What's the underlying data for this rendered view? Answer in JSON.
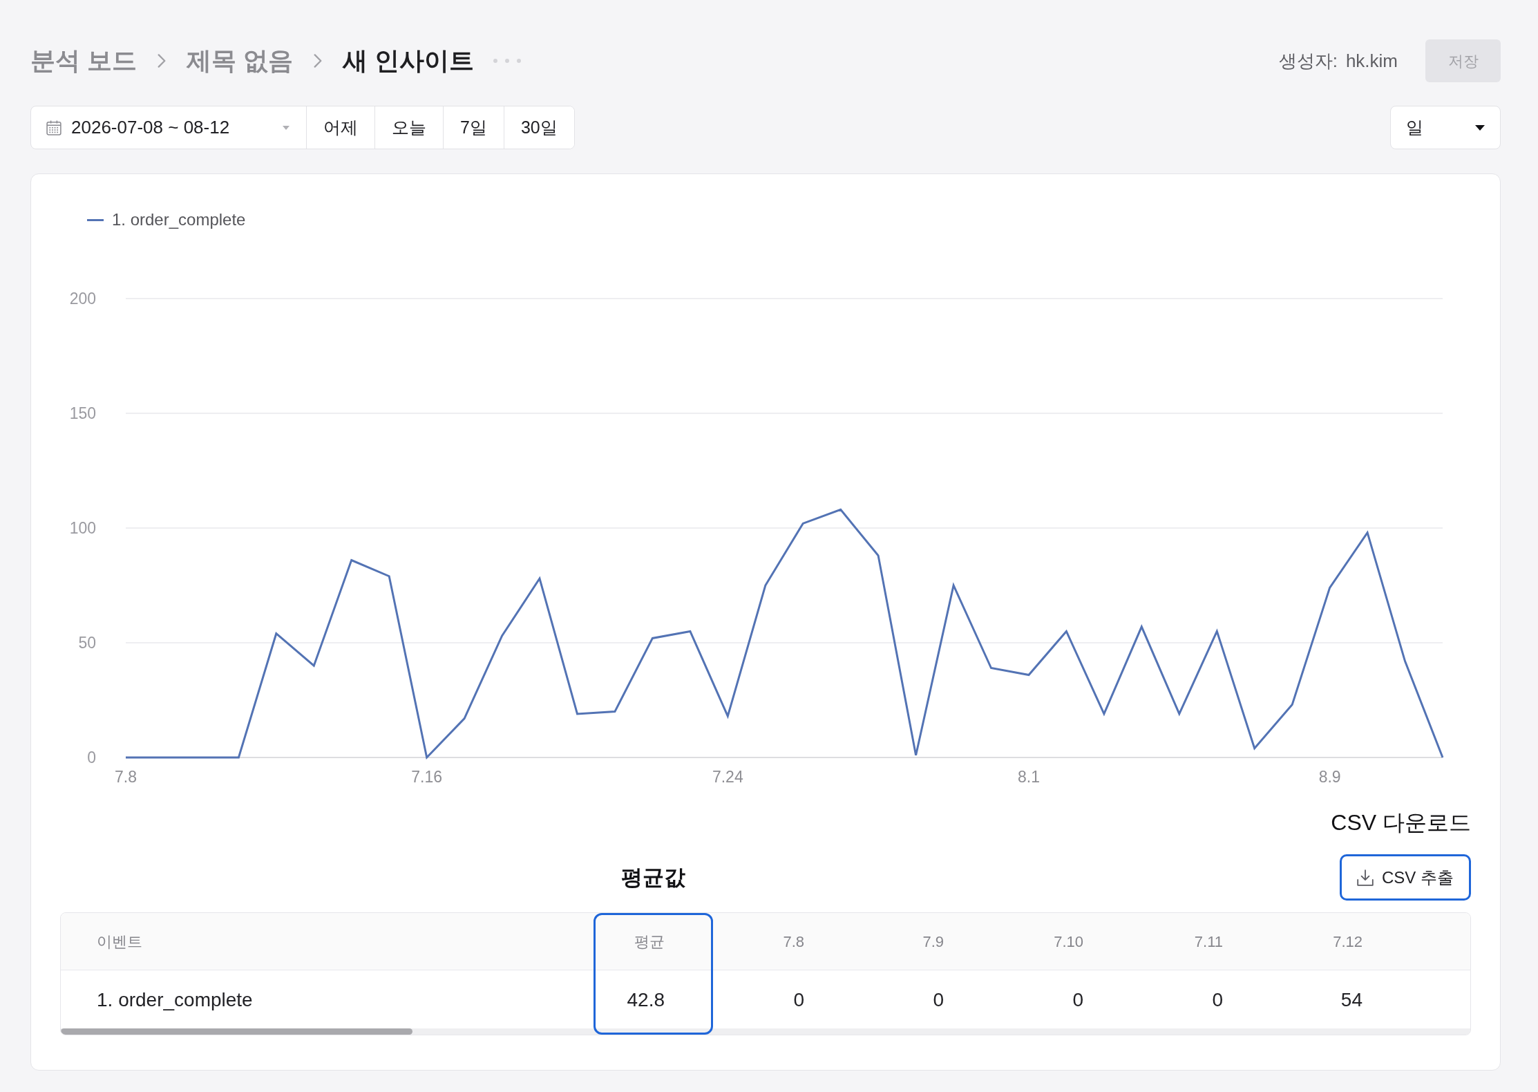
{
  "breadcrumb": [
    {
      "label": "분석 보드",
      "current": false
    },
    {
      "label": "제목 없음",
      "current": false
    },
    {
      "label": "새 인사이트",
      "current": true
    }
  ],
  "created_by": {
    "label": "생성자:",
    "value": "hk.kim"
  },
  "save_button": {
    "label": "저장",
    "disabled": true
  },
  "date_range": {
    "value": "2026-07-08 ~ 08-12"
  },
  "quick_ranges": [
    {
      "label": "어제",
      "selected": false
    },
    {
      "label": "오늘",
      "selected": false
    },
    {
      "label": "7일",
      "selected": false
    },
    {
      "label": "30일",
      "selected": false
    }
  ],
  "interval_select": {
    "value": "일"
  },
  "chart": {
    "chart_data": {
      "type": "line",
      "grid": true,
      "categories": [
        "7.8",
        null,
        null,
        null,
        null,
        null,
        null,
        null,
        "7.16",
        null,
        null,
        null,
        null,
        null,
        null,
        null,
        "7.24",
        null,
        null,
        null,
        null,
        null,
        null,
        null,
        "8.1",
        null,
        null,
        null,
        null,
        null,
        null,
        null,
        "8.9",
        null,
        null,
        null
      ],
      "ylim": [
        0,
        200
      ],
      "yticks": [
        0,
        50,
        100,
        150,
        200
      ],
      "series": [
        {
          "name": "1. order_complete",
          "color": "#5373b4",
          "values": [
            0,
            0,
            0,
            0,
            54,
            40,
            86,
            79,
            0,
            17,
            53,
            78,
            19,
            20,
            52,
            55,
            18,
            75,
            102,
            108,
            88,
            1,
            75,
            39,
            36,
            55,
            19,
            57,
            19,
            55,
            4,
            23,
            74,
            98,
            42,
            0
          ]
        }
      ]
    }
  },
  "annotations": {
    "csv": "CSV 다운로드",
    "average": "평균값"
  },
  "csv_button": {
    "label": "CSV 추출",
    "highlighted": true
  },
  "table": {
    "columns": [
      {
        "label": "이벤트",
        "highlighted": false
      },
      {
        "label": "평균",
        "highlighted": true
      },
      {
        "label": "7.8",
        "highlighted": false
      },
      {
        "label": "7.9",
        "highlighted": false
      },
      {
        "label": "7.10",
        "highlighted": false
      },
      {
        "label": "7.11",
        "highlighted": false
      },
      {
        "label": "7.12",
        "highlighted": false
      }
    ],
    "rows": [
      {
        "cells": [
          "1. order_complete",
          "42.8",
          "0",
          "0",
          "0",
          "0",
          "54"
        ]
      }
    ]
  }
}
